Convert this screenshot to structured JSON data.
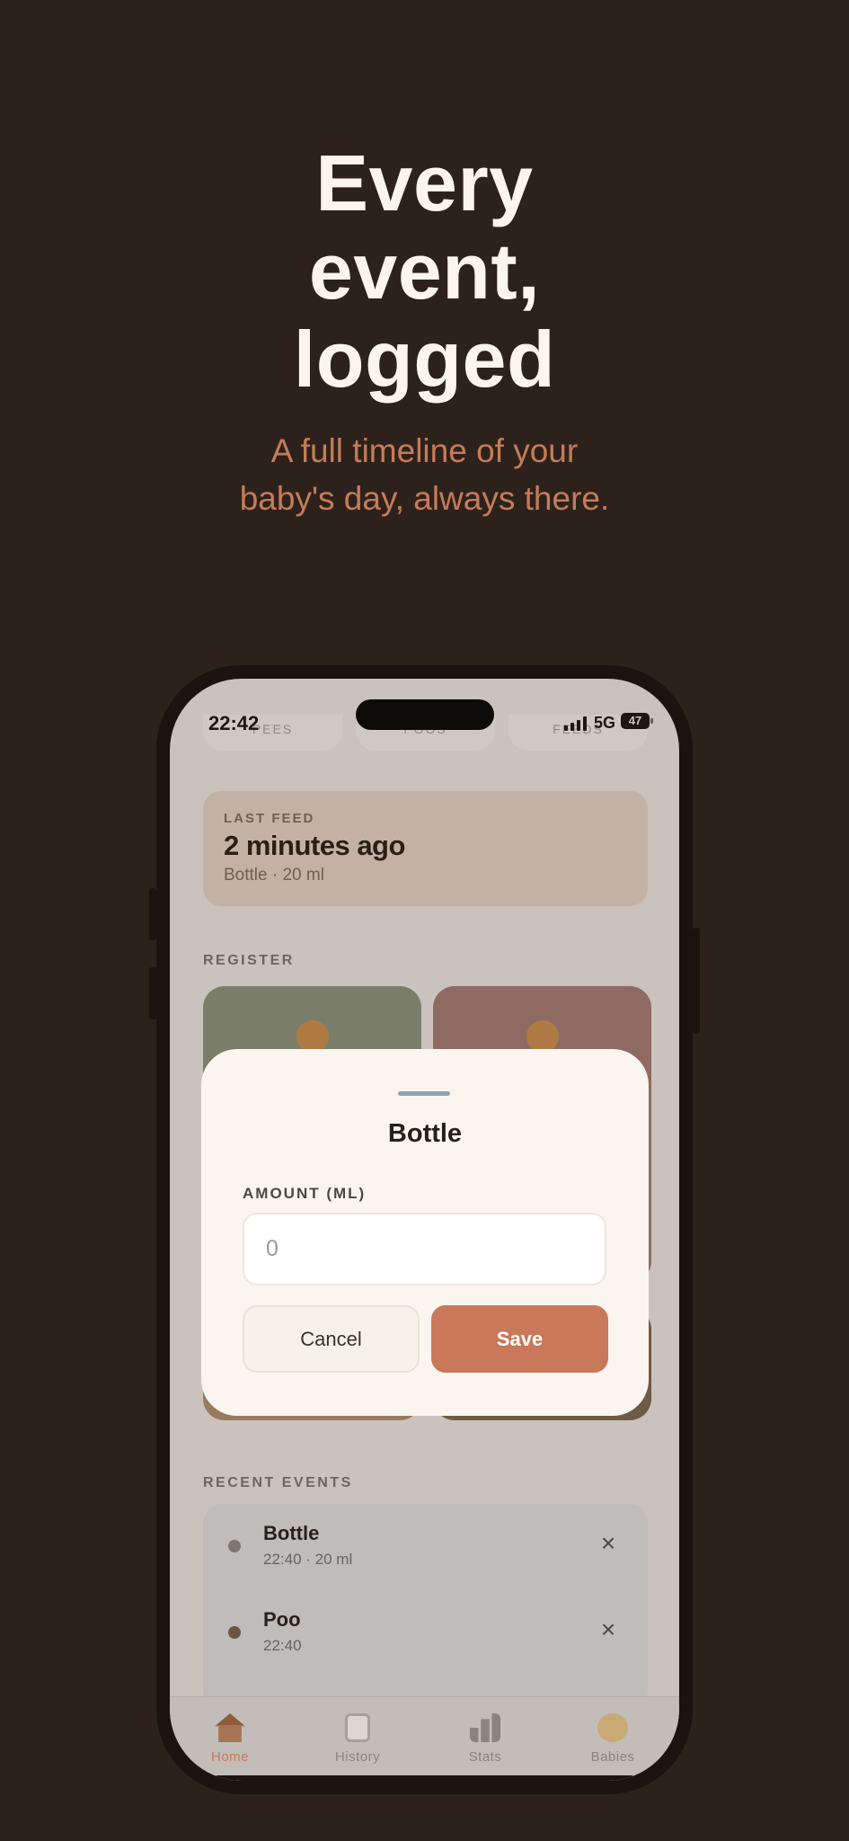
{
  "promo": {
    "headline_lines": [
      "Every",
      "event,",
      "logged"
    ],
    "subtitle_lines": [
      "A full timeline of your",
      "baby's day, always there."
    ]
  },
  "status_bar": {
    "time": "22:42",
    "network": "5G",
    "battery": "47"
  },
  "stat_pills": [
    "PEES",
    "POOS",
    "FEEDS"
  ],
  "last_feed": {
    "label": "LAST FEED",
    "value": "2 minutes ago",
    "detail": "Bottle · 20 ml"
  },
  "register": {
    "label": "REGISTER",
    "tile_colors": [
      "#7a7e69",
      "#8f6a62",
      "#9a7a5f",
      "#6e5b45"
    ]
  },
  "recent_events": {
    "label": "RECENT EVENTS",
    "items": [
      {
        "title": "Bottle",
        "subtitle": "22:40 · 20 ml",
        "dot_color": "#7d7670",
        "remove_icon": "×"
      },
      {
        "title": "Poo",
        "subtitle": "22:40",
        "dot_color": "#6b5641",
        "remove_icon": "×"
      }
    ]
  },
  "tab_bar": {
    "items": [
      {
        "label": "Home",
        "icon": "house-icon",
        "active": true
      },
      {
        "label": "History",
        "icon": "clipboard-icon",
        "active": false
      },
      {
        "label": "Stats",
        "icon": "bar-chart-icon",
        "active": false
      },
      {
        "label": "Babies",
        "icon": "baby-face-icon",
        "active": false
      }
    ],
    "active_color": "#c9785a"
  },
  "modal": {
    "title": "Bottle",
    "field_label": "AMOUNT (ML)",
    "amount_value": "",
    "amount_placeholder": "0",
    "cancel_label": "Cancel",
    "save_label": "Save"
  },
  "colors": {
    "background": "#2d221b",
    "accent": "#c9785a",
    "subtitle": "#c57c5a"
  }
}
